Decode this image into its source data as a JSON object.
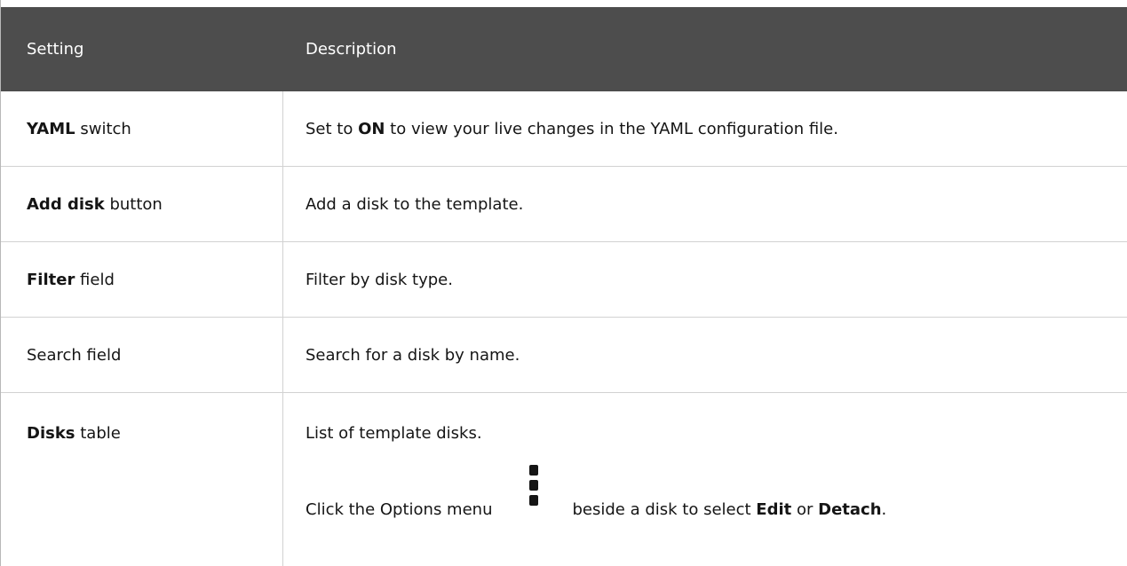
{
  "header": {
    "col_setting": "Setting",
    "col_description": "Description"
  },
  "rows": [
    {
      "setting_bold": "YAML",
      "setting_rest": " switch",
      "desc_pre": "Set to ",
      "desc_bold": "ON",
      "desc_post": " to view your live changes in the YAML configuration file."
    },
    {
      "setting_bold": "Add disk",
      "setting_rest": " button",
      "desc": "Add a disk to the template."
    },
    {
      "setting_bold": "Filter",
      "setting_rest": " field",
      "desc": "Filter by disk type."
    },
    {
      "setting": "Search field",
      "desc": "Search for a disk by name."
    },
    {
      "setting_bold": "Disks",
      "setting_rest": " table",
      "desc_line1": "List of template disks.",
      "desc_line2_pre": "Click the Options menu",
      "desc_line2_mid": "beside a disk to select ",
      "desc_line2_bold1": "Edit",
      "desc_line2_or": " or ",
      "desc_line2_bold2": "Detach",
      "desc_line2_end": ".",
      "icon": "kebab-icon"
    }
  ]
}
